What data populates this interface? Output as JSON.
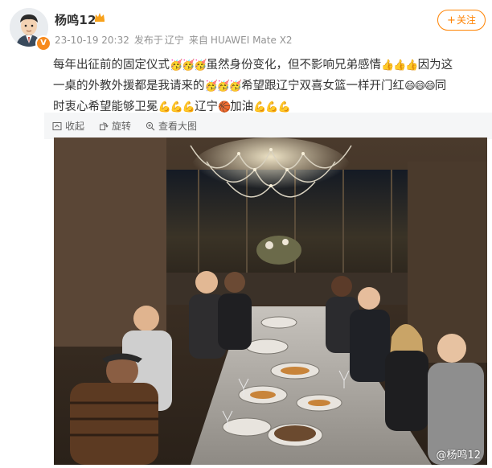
{
  "user": {
    "name": "杨鸣12",
    "verified_badge": "V",
    "timestamp": "23-10-19 20:32",
    "published_from_label": "发布于",
    "location": "辽宁",
    "device_label": "来自",
    "device": "HUAWEI Mate X2"
  },
  "follow_button": {
    "plus": "+",
    "label": "关注"
  },
  "post": {
    "line1_text1": "每年出征前的固定仪式",
    "line1_emo1": "🥳🥳🥳",
    "line1_text2": "虽然身份变化，但不影响兄弟感情",
    "line1_emo2": "👍👍👍",
    "line1_text3": "因为这",
    "line2_text1": "一桌的外教外援都是我请来的",
    "line2_emo1": "🥳🥳🥳",
    "line2_text2": "希望跟辽宁双喜女篮一样开门红",
    "line2_emo2": "😄😄😄",
    "line2_text3": "同",
    "line3_text1": "时衷心希望能够卫冕",
    "line3_emo1": "💪💪💪",
    "line3_text2": "辽宁",
    "line3_emo2": "🏀",
    "line3_text3": "加油",
    "line3_emo3": "💪💪💪"
  },
  "toolbar": {
    "collect": "收起",
    "rotate": "旋转",
    "view_large": "查看大图"
  },
  "photo": {
    "watermark": "@杨鸣12"
  },
  "colors": {
    "accent": "#ff8200",
    "toolbar_bg": "#f5f6f7"
  }
}
